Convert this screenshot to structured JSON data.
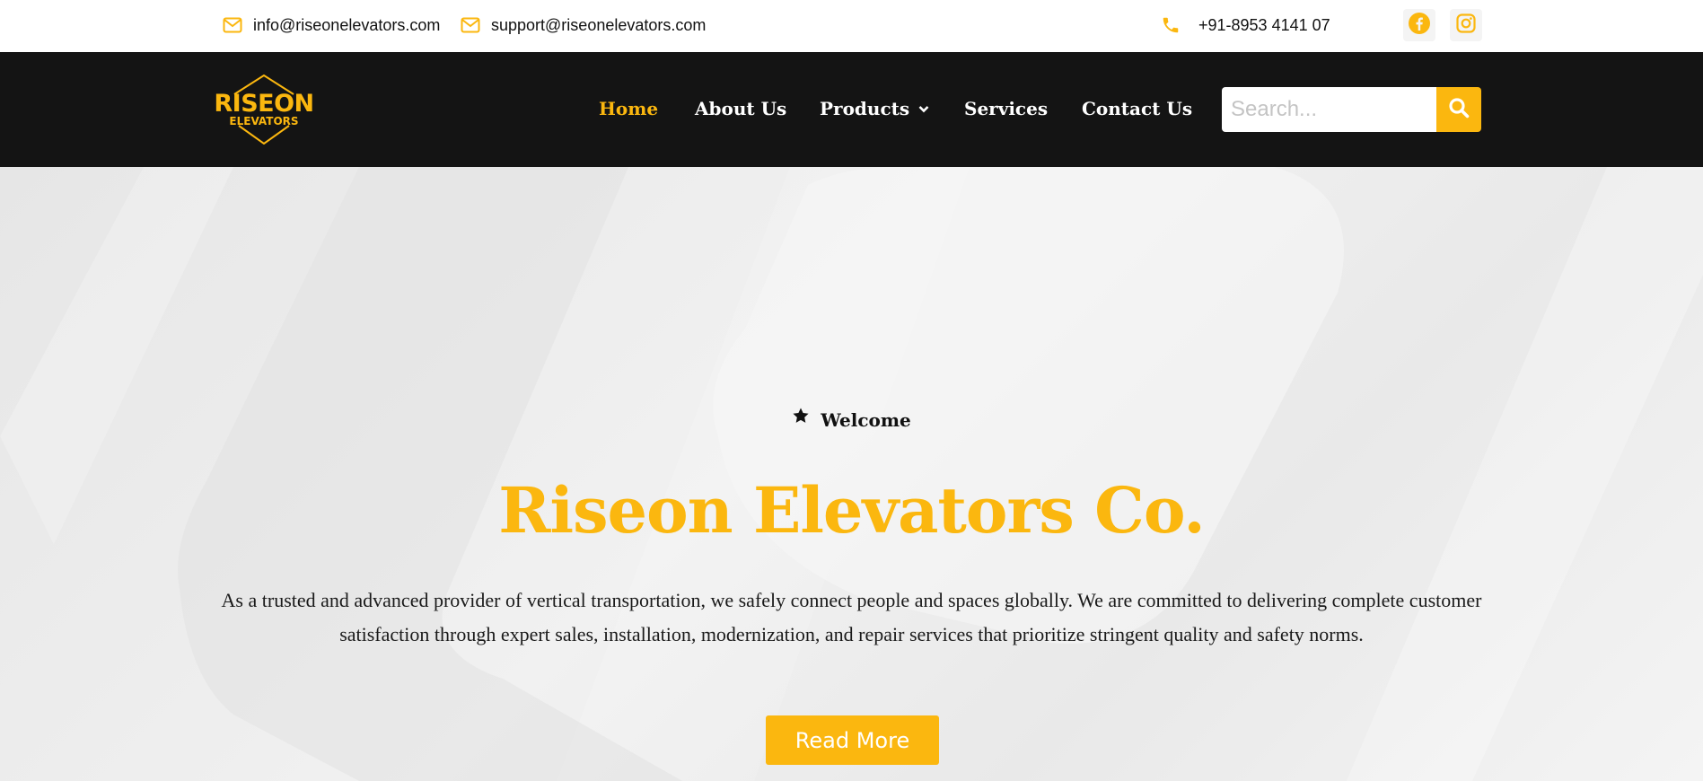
{
  "topbar": {
    "email_primary": "info@riseonelevators.com",
    "email_support": "support@riseonelevators.com",
    "phone": "+91-8953 4141 07",
    "icons": {
      "email": "envelope-icon",
      "phone": "phone-icon",
      "facebook": "facebook-icon",
      "instagram": "instagram-icon"
    }
  },
  "logo": {
    "line1": "RISEON",
    "line2": "ELEVATORS"
  },
  "nav": {
    "items": [
      {
        "label": "Home",
        "active": true
      },
      {
        "label": "About Us"
      },
      {
        "label": "Products",
        "has_dropdown": true
      },
      {
        "label": "Services"
      },
      {
        "label": "Contact Us"
      }
    ]
  },
  "search": {
    "placeholder": "Search...",
    "icon": "search-icon"
  },
  "hero": {
    "eyebrow": "Welcome",
    "eyebrow_icon": "star-icon",
    "title": "Riseon Elevators Co.",
    "description": "As a trusted and advanced provider of vertical transportation, we safely connect people and spaces globally. We are committed to delivering complete customer satisfaction through expert sales, installation, modernization, and repair services that prioritize stringent quality and safety norms.",
    "cta": "Read More"
  },
  "colors": {
    "accent": "#fbb70f",
    "nav_bg": "#141414",
    "hero_bg": "#ececec",
    "text": "#111111"
  }
}
